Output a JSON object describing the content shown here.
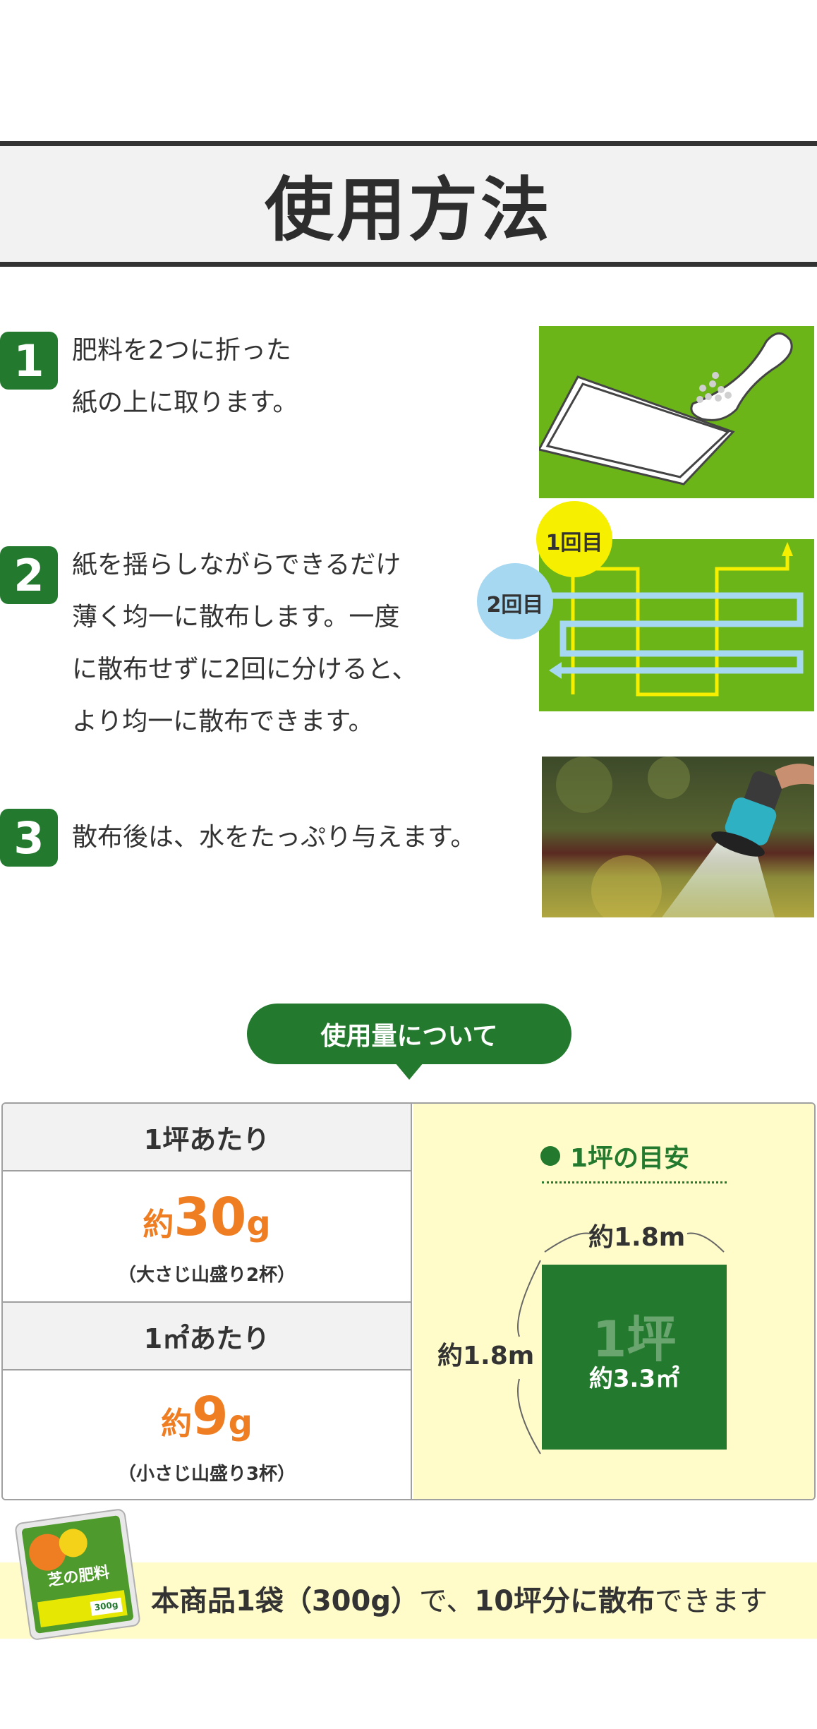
{
  "section_title": "使用方法",
  "steps": [
    {
      "number": "1",
      "lines": [
        "肥料を2つに折った",
        "紙の上に取ります。"
      ]
    },
    {
      "number": "2",
      "lines": [
        "紙を揺らしながらできるだけ",
        "薄く均一に散布します。一度",
        "に散布せずに2回に分けると、",
        "より均一に散布できます。"
      ],
      "illustration_labels": {
        "first": "1回目",
        "second": "2回目"
      }
    },
    {
      "number": "3",
      "lines": [
        "散布後は、水をたっぷり与えます。"
      ]
    }
  ],
  "usage": {
    "pill_label": "使用量について",
    "per_tsubo": {
      "header": "1坪あたり",
      "prefix": "約",
      "amount": "30",
      "unit": "g",
      "note": "（大さじ山盛り2杯）"
    },
    "per_sqm": {
      "header": "1㎡あたり",
      "prefix": "約",
      "amount": "9",
      "unit": "g",
      "note": "（小さじ山盛り3杯）"
    },
    "guide": {
      "title": "1坪の目安",
      "width": "約1.8m",
      "height": "約1.8m",
      "square_label": "1坪",
      "square_area": "約3.3㎡"
    }
  },
  "bottom": {
    "part1": "本商品1袋（300g）",
    "part2": "で、",
    "part3": "10坪分に散布",
    "part4": "できます",
    "product": {
      "brand": "芝の肥料",
      "weight": "300g"
    }
  },
  "colors": {
    "green": "#237a2e",
    "light_green": "#6cb519",
    "orange": "#ef7d22",
    "cream": "#fffcc9",
    "yellow": "#f7ef00",
    "light_blue": "#a6d8f2"
  }
}
